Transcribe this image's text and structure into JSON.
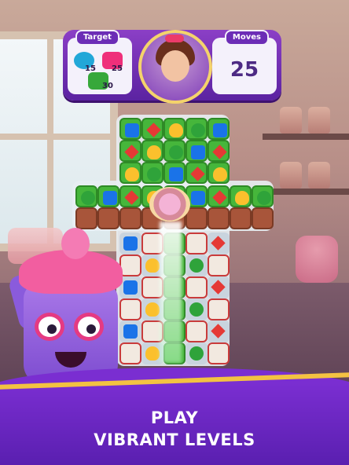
{
  "hud": {
    "target_label": "Target",
    "moves_label": "Moves",
    "moves_value": "25",
    "targets": [
      {
        "icon": "blue-bow-gift-icon",
        "count": "15"
      },
      {
        "icon": "pink-gem-icon",
        "count": "25"
      },
      {
        "icon": "grass-tile-icon",
        "count": "30"
      }
    ]
  },
  "banner": {
    "line1": "PLAY",
    "line2": "VIBRANT LEVELS"
  },
  "colors": {
    "hud_purple": "#6c2db6",
    "banner_purple": "#7a2ed1",
    "gold_accent": "#f3c242"
  }
}
